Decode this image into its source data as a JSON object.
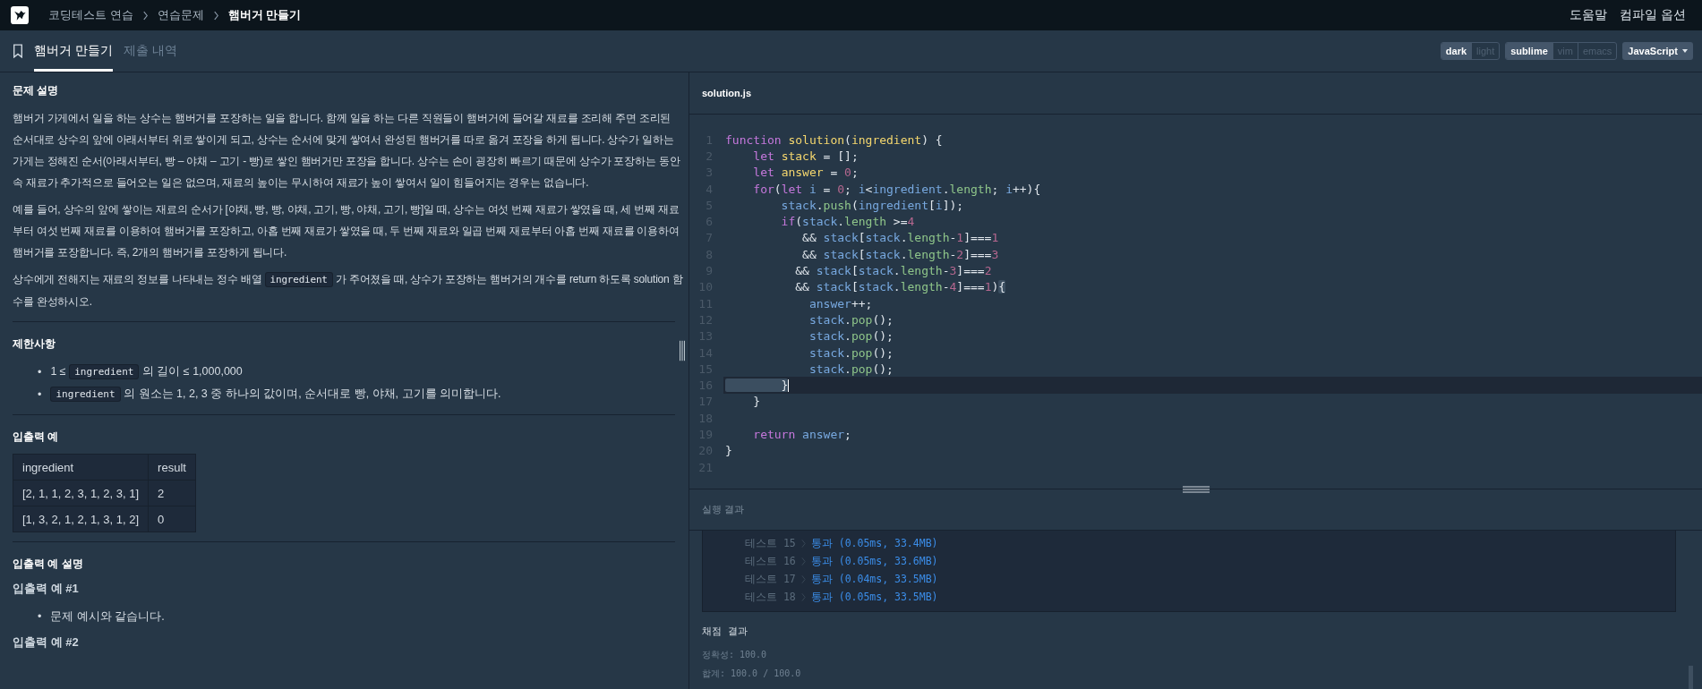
{
  "top_bar": {
    "breadcrumbs": [
      {
        "label": "코딩테스트 연습",
        "current": false
      },
      {
        "label": "연습문제",
        "current": false
      },
      {
        "label": "햄버거 만들기",
        "current": true
      }
    ],
    "links": [
      "도움말",
      "컴파일 옵션"
    ]
  },
  "tabs": [
    {
      "label": "햄버거 만들기",
      "selected": true
    },
    {
      "label": "제출 내역",
      "selected": false
    }
  ],
  "toolbar": {
    "groups": [
      [
        {
          "label": "dark",
          "selected": true
        },
        {
          "label": "light",
          "selected": false
        }
      ],
      [
        {
          "label": "sublime",
          "selected": true
        },
        {
          "label": "vim",
          "selected": false
        },
        {
          "label": "emacs",
          "selected": false
        }
      ]
    ],
    "language": "JavaScript"
  },
  "problem": {
    "title": "문제 설명",
    "paragraphs": [
      [
        {
          "kind": "text",
          "text": "햄버거 가게에서 일을 하는 상수는 햄버거를 포장하는 일을 합니다. 함께 일을 하는 다른 직원들이 햄버거에 들어갈 재료를 조리해 주면 조리된 순서대로 상수의 앞에 아래서부터 위로 쌓이게 되고, 상수는 순서에 맞게 쌓여서 완성된 햄버거를 따로 옮겨 포장을 하게 됩니다. 상수가 일하는 가게는 정해진 순서(아래서부터, 빵 – 야채 – 고기 - 빵)로 쌓인 햄버거만 포장을 합니다. 상수는 손이 굉장히 빠르기 때문에 상수가 포장하는 동안 속 재료가 추가적으로 들어오는 일은 없으며, 재료의 높이는 무시하여 재료가 높이 쌓여서 일이 힘들어지는 경우는 없습니다."
        }
      ],
      [
        {
          "kind": "text",
          "text": "예를 들어, 상수의 앞에 쌓이는 재료의 순서가 [야채, 빵, 빵, 야채, 고기, 빵, 야채, 고기, 빵]일 때, 상수는 여섯 번째 재료가 쌓였을 때, 세 번째 재료부터 여섯 번째 재료를 이용하여 햄버거를 포장하고, 아홉 번째 재료가 쌓였을 때, 두 번째 재료와 일곱 번째 재료부터 아홉 번째 재료를 이용하여 햄버거를 포장합니다. 즉, 2개의 햄버거를 포장하게 됩니다."
        }
      ],
      [
        {
          "kind": "text",
          "text": "상수에게 전해지는 재료의 정보를 나타내는 정수 배열 "
        },
        {
          "kind": "code",
          "text": "ingredient"
        },
        {
          "kind": "text",
          "text": " 가 주어졌을 때, 상수가 포장하는 햄버거의 개수를 return 하도록 solution 함수를 완성하시오."
        }
      ]
    ]
  },
  "constraints": {
    "title": "제한사항",
    "items": [
      {
        "marker": "•",
        "segments": [
          {
            "kind": "text",
            "text": "1 ≤ "
          },
          {
            "kind": "code",
            "text": "ingredient"
          },
          {
            "kind": "text",
            "text": " 의 길이 ≤ 1,000,000"
          }
        ]
      },
      {
        "marker": "•",
        "segments": [
          {
            "kind": "code",
            "text": "ingredient"
          },
          {
            "kind": "text",
            "text": " 의 원소는 1, 2, 3 중 하나의 값이며, 순서대로 빵, 야채, 고기를 의미합니다."
          }
        ]
      }
    ]
  },
  "examples": {
    "title": "입출력 예",
    "columns": [
      "ingredient",
      "result"
    ],
    "rows": [
      [
        "[2, 1, 1, 2, 3, 1, 2, 3, 1]",
        "2"
      ],
      [
        "[1, 3, 2, 1, 2, 1, 3, 1, 2]",
        "0"
      ]
    ]
  },
  "explanation": {
    "title": "입출력 예 설명",
    "sections": [
      {
        "title": "입출력 예 #1",
        "items": [
          {
            "marker": "•",
            "text": "문제 예시와 같습니다."
          }
        ]
      },
      {
        "title": "입출력 예 #2"
      }
    ]
  },
  "editor": {
    "filename": "solution.js",
    "lines": [
      {
        "number": "1",
        "current": false,
        "tokens": [
          {
            "kind": "kw",
            "text": "function "
          },
          {
            "kind": "def",
            "text": "solution"
          },
          {
            "kind": "p",
            "text": "("
          },
          {
            "kind": "def",
            "text": "ingredient"
          },
          {
            "kind": "p",
            "text": ") {"
          }
        ]
      },
      {
        "number": "2",
        "current": false,
        "tokens": [
          {
            "kind": "kw",
            "text": "    let "
          },
          {
            "kind": "def",
            "text": "stack"
          },
          {
            "kind": "p",
            "text": " = [];"
          }
        ]
      },
      {
        "number": "3",
        "current": false,
        "tokens": [
          {
            "kind": "kw",
            "text": "    let "
          },
          {
            "kind": "def",
            "text": "answer"
          },
          {
            "kind": "p",
            "text": " = "
          },
          {
            "kind": "num",
            "text": "0"
          },
          {
            "kind": "p",
            "text": ";"
          }
        ]
      },
      {
        "number": "4",
        "current": false,
        "tokens": [
          {
            "kind": "kw",
            "text": "    for"
          },
          {
            "kind": "p",
            "text": "("
          },
          {
            "kind": "kw",
            "text": "let "
          },
          {
            "kind": "var",
            "text": "i"
          },
          {
            "kind": "p",
            "text": " = "
          },
          {
            "kind": "num",
            "text": "0"
          },
          {
            "kind": "p",
            "text": "; "
          },
          {
            "kind": "var",
            "text": "i"
          },
          {
            "kind": "p",
            "text": "<"
          },
          {
            "kind": "var",
            "text": "ingredient"
          },
          {
            "kind": "p",
            "text": "."
          },
          {
            "kind": "prop",
            "text": "length"
          },
          {
            "kind": "p",
            "text": "; "
          },
          {
            "kind": "var",
            "text": "i"
          },
          {
            "kind": "p",
            "text": "++){"
          }
        ]
      },
      {
        "number": "5",
        "current": false,
        "tokens": [
          {
            "kind": "var",
            "text": "        stack"
          },
          {
            "kind": "p",
            "text": "."
          },
          {
            "kind": "prop",
            "text": "push"
          },
          {
            "kind": "p",
            "text": "("
          },
          {
            "kind": "var",
            "text": "ingredient"
          },
          {
            "kind": "p",
            "text": "["
          },
          {
            "kind": "var",
            "text": "i"
          },
          {
            "kind": "p",
            "text": "]);"
          }
        ]
      },
      {
        "number": "6",
        "current": false,
        "tokens": [
          {
            "kind": "kw",
            "text": "        if"
          },
          {
            "kind": "p",
            "text": "("
          },
          {
            "kind": "var",
            "text": "stack"
          },
          {
            "kind": "p",
            "text": "."
          },
          {
            "kind": "prop",
            "text": "length"
          },
          {
            "kind": "p",
            "text": " >="
          },
          {
            "kind": "num",
            "text": "4"
          }
        ]
      },
      {
        "number": "7",
        "current": false,
        "tokens": [
          {
            "kind": "p",
            "text": "           && "
          },
          {
            "kind": "var",
            "text": "stack"
          },
          {
            "kind": "p",
            "text": "["
          },
          {
            "kind": "var",
            "text": "stack"
          },
          {
            "kind": "p",
            "text": "."
          },
          {
            "kind": "prop",
            "text": "length"
          },
          {
            "kind": "p",
            "text": "-"
          },
          {
            "kind": "num",
            "text": "1"
          },
          {
            "kind": "p",
            "text": "]==="
          },
          {
            "kind": "num",
            "text": "1"
          }
        ]
      },
      {
        "number": "8",
        "current": false,
        "tokens": [
          {
            "kind": "p",
            "text": "           && "
          },
          {
            "kind": "var",
            "text": "stack"
          },
          {
            "kind": "p",
            "text": "["
          },
          {
            "kind": "var",
            "text": "stack"
          },
          {
            "kind": "p",
            "text": "."
          },
          {
            "kind": "prop",
            "text": "length"
          },
          {
            "kind": "p",
            "text": "-"
          },
          {
            "kind": "num",
            "text": "2"
          },
          {
            "kind": "p",
            "text": "]==="
          },
          {
            "kind": "num",
            "text": "3"
          }
        ]
      },
      {
        "number": "9",
        "current": false,
        "tokens": [
          {
            "kind": "p",
            "text": "          && "
          },
          {
            "kind": "var",
            "text": "stack"
          },
          {
            "kind": "p",
            "text": "["
          },
          {
            "kind": "var",
            "text": "stack"
          },
          {
            "kind": "p",
            "text": "."
          },
          {
            "kind": "prop",
            "text": "length"
          },
          {
            "kind": "p",
            "text": "-"
          },
          {
            "kind": "num",
            "text": "3"
          },
          {
            "kind": "p",
            "text": "]==="
          },
          {
            "kind": "num",
            "text": "2"
          }
        ]
      },
      {
        "number": "10",
        "current": false,
        "tokens": [
          {
            "kind": "p",
            "text": "          && "
          },
          {
            "kind": "var",
            "text": "stack"
          },
          {
            "kind": "p",
            "text": "["
          },
          {
            "kind": "var",
            "text": "stack"
          },
          {
            "kind": "p",
            "text": "."
          },
          {
            "kind": "prop",
            "text": "length"
          },
          {
            "kind": "p",
            "text": "-"
          },
          {
            "kind": "num",
            "text": "4"
          },
          {
            "kind": "p",
            "text": "]==="
          },
          {
            "kind": "num",
            "text": "1"
          },
          {
            "kind": "p",
            "text": ")"
          },
          {
            "kind": "match",
            "text": "{"
          }
        ]
      },
      {
        "number": "11",
        "current": false,
        "tokens": [
          {
            "kind": "var",
            "text": "            answer"
          },
          {
            "kind": "p",
            "text": "++;"
          }
        ]
      },
      {
        "number": "12",
        "current": false,
        "tokens": [
          {
            "kind": "var",
            "text": "            stack"
          },
          {
            "kind": "p",
            "text": "."
          },
          {
            "kind": "prop",
            "text": "pop"
          },
          {
            "kind": "p",
            "text": "();"
          }
        ]
      },
      {
        "number": "13",
        "current": false,
        "tokens": [
          {
            "kind": "var",
            "text": "            stack"
          },
          {
            "kind": "p",
            "text": "."
          },
          {
            "kind": "prop",
            "text": "pop"
          },
          {
            "kind": "p",
            "text": "();"
          }
        ]
      },
      {
        "number": "14",
        "current": false,
        "tokens": [
          {
            "kind": "var",
            "text": "            stack"
          },
          {
            "kind": "p",
            "text": "."
          },
          {
            "kind": "prop",
            "text": "pop"
          },
          {
            "kind": "p",
            "text": "();"
          }
        ]
      },
      {
        "number": "15",
        "current": false,
        "tokens": [
          {
            "kind": "var",
            "text": "            stack"
          },
          {
            "kind": "p",
            "text": "."
          },
          {
            "kind": "prop",
            "text": "pop"
          },
          {
            "kind": "p",
            "text": "();"
          }
        ]
      },
      {
        "number": "16",
        "current": true,
        "tokens": [
          {
            "kind": "match",
            "text": "        }"
          }
        ]
      },
      {
        "number": "17",
        "current": false,
        "tokens": [
          {
            "kind": "p",
            "text": "    }"
          }
        ]
      },
      {
        "number": "18",
        "current": false
      },
      {
        "number": "19",
        "current": false,
        "tokens": [
          {
            "kind": "kw",
            "text": "    return "
          },
          {
            "kind": "var",
            "text": "answer"
          },
          {
            "kind": "p",
            "text": ";"
          }
        ]
      },
      {
        "number": "20",
        "current": false,
        "tokens": [
          {
            "kind": "p",
            "text": "}"
          }
        ]
      },
      {
        "number": "21",
        "current": false
      }
    ]
  },
  "results": {
    "title": "실행 결과",
    "tests": [
      {
        "label": "테스트 15",
        "result": "통과 (0.05ms, 33.4MB)"
      },
      {
        "label": "테스트 16",
        "result": "통과 (0.05ms, 33.6MB)"
      },
      {
        "label": "테스트 17",
        "result": "통과 (0.04ms, 33.5MB)"
      },
      {
        "label": "테스트 18",
        "result": "통과 (0.05ms, 33.5MB)"
      }
    ],
    "score_title": "채점 결과",
    "score_lines": [
      "정확성: 100.0",
      "합계: 100.0 / 100.0"
    ]
  }
}
